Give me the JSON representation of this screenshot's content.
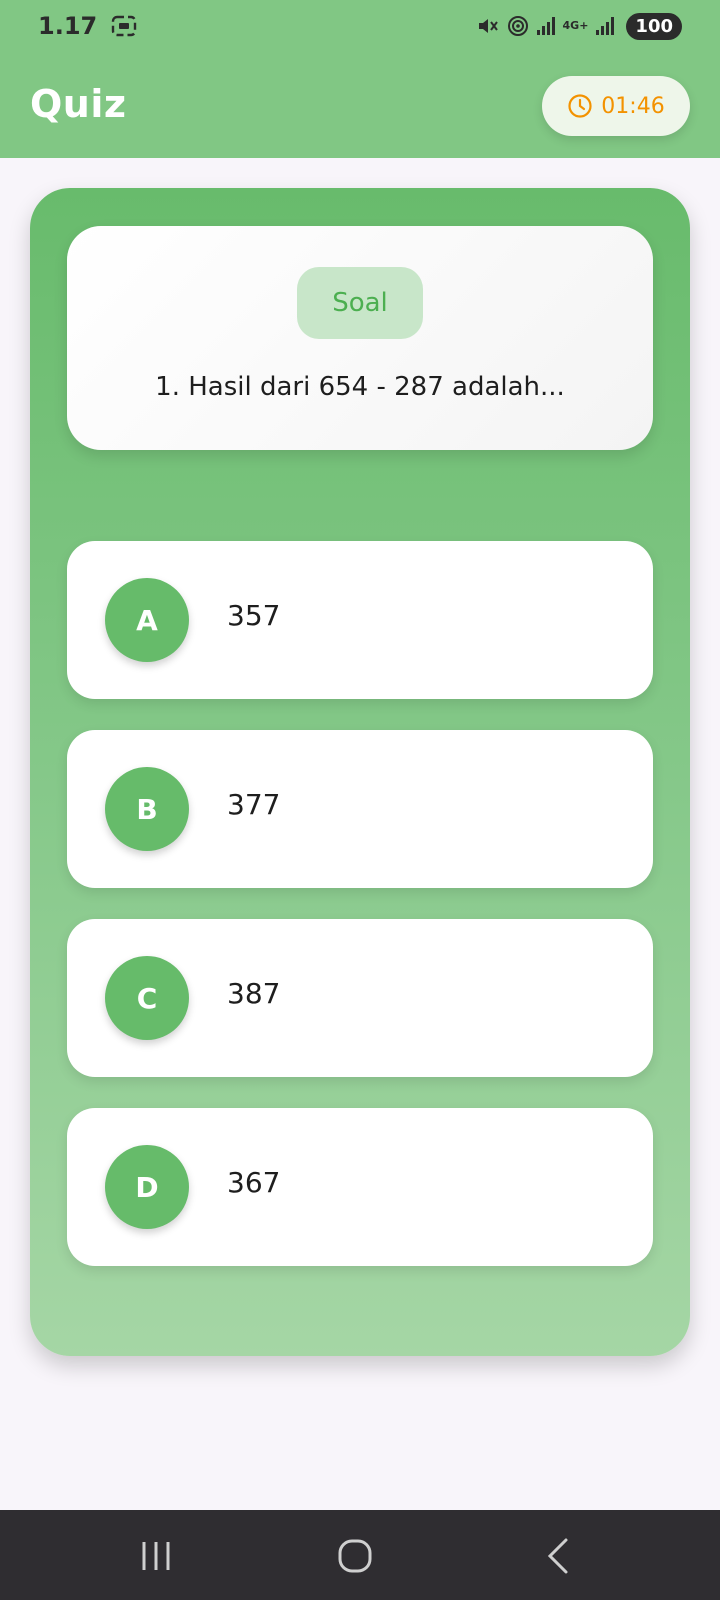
{
  "status": {
    "time": "1.17",
    "network": "4G+",
    "battery": "100"
  },
  "header": {
    "title": "Quiz",
    "timer": "01:46"
  },
  "question": {
    "badge": "Soal",
    "text": "1. Hasil dari 654 - 287 adalah..."
  },
  "options": [
    {
      "letter": "A",
      "value": "357"
    },
    {
      "letter": "B",
      "value": "377"
    },
    {
      "letter": "C",
      "value": "387"
    },
    {
      "letter": "D",
      "value": "367"
    }
  ],
  "colors": {
    "primary": "#81c784",
    "accent_green": "#66bb6a",
    "timer": "#f39200",
    "badge_bg": "#c8e6c9"
  },
  "icons": {
    "status_left": "screenshot-icon",
    "timer": "clock-icon",
    "nav": [
      "recent-apps-icon",
      "home-icon",
      "back-icon"
    ]
  }
}
